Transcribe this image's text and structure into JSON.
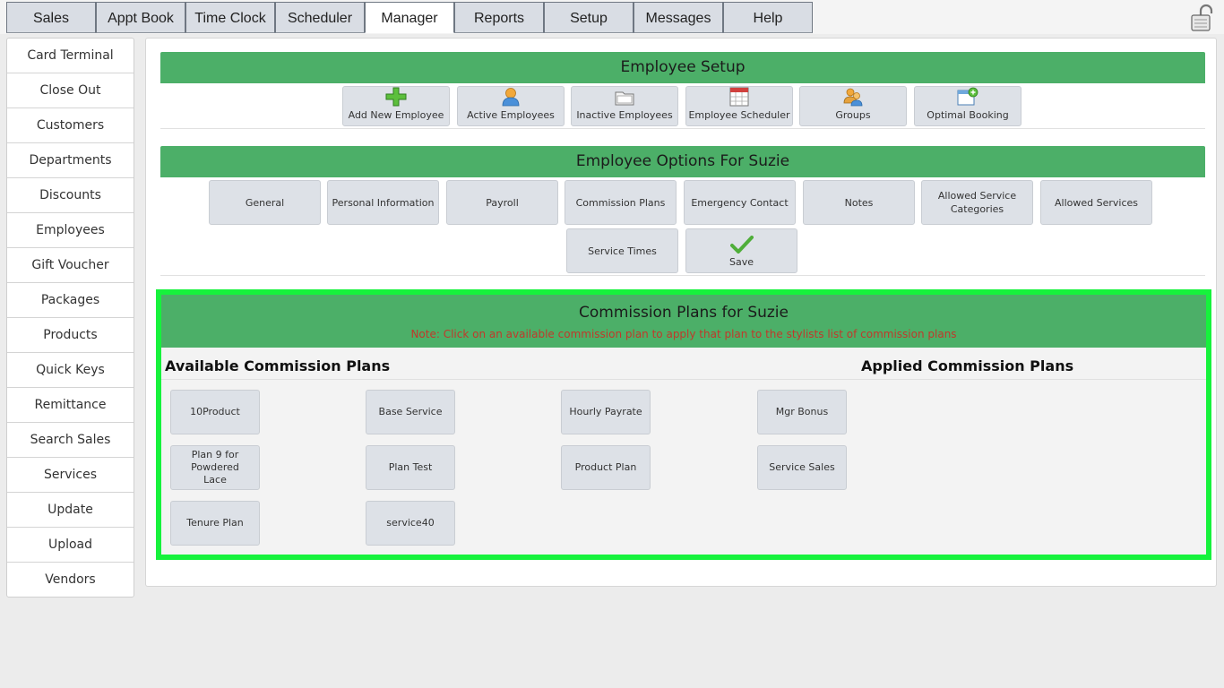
{
  "top_tabs": [
    "Sales",
    "Appt Book",
    "Time Clock",
    "Scheduler",
    "Manager",
    "Reports",
    "Setup",
    "Messages",
    "Help"
  ],
  "active_tab": "Manager",
  "sidebar": {
    "items": [
      {
        "label": "Card Terminal"
      },
      {
        "label": "Close Out"
      },
      {
        "label": "Customers"
      },
      {
        "label": "Departments"
      },
      {
        "label": "Discounts"
      },
      {
        "label": "Employees"
      },
      {
        "label": "Gift Voucher"
      },
      {
        "label": "Packages"
      },
      {
        "label": "Products"
      },
      {
        "label": "Quick Keys"
      },
      {
        "label": "Remittance"
      },
      {
        "label": "Search Sales"
      },
      {
        "label": "Services"
      },
      {
        "label": "Update"
      },
      {
        "label": "Upload"
      },
      {
        "label": "Vendors"
      }
    ]
  },
  "employee_setup": {
    "title": "Employee Setup",
    "buttons": [
      {
        "label": "Add New Employee",
        "icon": "plus-icon"
      },
      {
        "label": "Active Employees",
        "icon": "person-icon"
      },
      {
        "label": "Inactive Employees",
        "icon": "folder-icon"
      },
      {
        "label": "Employee Scheduler",
        "icon": "calendar-icon"
      },
      {
        "label": "Groups",
        "icon": "group-icon"
      },
      {
        "label": "Optimal Booking",
        "icon": "booking-icon"
      }
    ]
  },
  "employee_options": {
    "title": "Employee Options For Suzie",
    "buttons": [
      {
        "label": "General"
      },
      {
        "label": "Personal Information"
      },
      {
        "label": "Payroll"
      },
      {
        "label": "Commission Plans"
      },
      {
        "label": "Emergency Contact"
      },
      {
        "label": "Notes"
      },
      {
        "label": "Allowed Service Categories"
      },
      {
        "label": "Allowed Services"
      },
      {
        "label": "Service Times"
      },
      {
        "label": "Save",
        "icon": "checkmark-icon"
      }
    ]
  },
  "commission": {
    "title": "Commission Plans for Suzie",
    "note": "Note: Click on an available commission plan to apply that plan to the stylists list of commission plans",
    "available_title": "Available Commission Plans",
    "applied_title": "Applied Commission Plans",
    "available_plans": [
      {
        "label": "10Product"
      },
      {
        "label": "Base Service"
      },
      {
        "label": "Hourly Payrate"
      },
      {
        "label": "Mgr Bonus"
      },
      {
        "label": "Plan 9 for Powdered Lace"
      },
      {
        "label": "Plan Test"
      },
      {
        "label": "Product Plan"
      },
      {
        "label": "Service Sales"
      },
      {
        "label": "Tenure Plan"
      },
      {
        "label": "service40"
      }
    ],
    "applied_plans": []
  },
  "colors": {
    "header_green": "#4caf68",
    "highlight_border": "#16f23c",
    "note_red": "#c0392b"
  }
}
